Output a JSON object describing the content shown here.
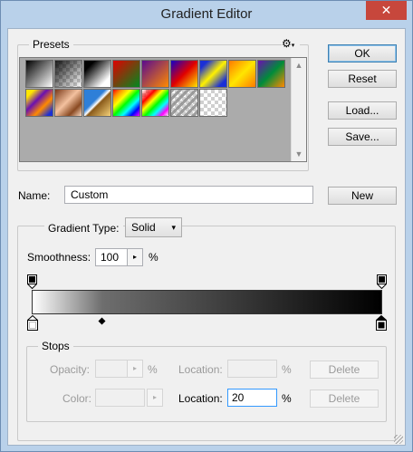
{
  "window": {
    "title": "Gradient Editor",
    "close_glyph": "✕"
  },
  "presets": {
    "label": "Presets",
    "menu_icon": "gear-icon",
    "swatches_row1": [
      "black-white-gradient",
      "transparent-black-gradient",
      "black-white-gradient-2",
      "red-green-gradient",
      "violet-orange-gradient",
      "blue-red-yellow-gradient",
      "blue-yellow-blue-gradient",
      "orange-yellow-orange-gradient",
      "violet-green-orange-gradient"
    ],
    "swatches_row2": [
      "yellow-violet-orange-blue-gradient",
      "copper-gradient",
      "chrome-gradient",
      "spectrum-gradient",
      "transparent-rainbow-gradient",
      "transparent-stripes-gradient",
      "transparent-checker-gradient"
    ]
  },
  "buttons": {
    "ok": "OK",
    "reset": "Reset",
    "load": "Load...",
    "save": "Save...",
    "new": "New"
  },
  "name": {
    "label": "Name:",
    "value": "Custom"
  },
  "gradient": {
    "type_label": "Gradient Type:",
    "type_value": "Solid",
    "smoothness_label": "Smoothness:",
    "smoothness_value": "100",
    "smoothness_unit": "%",
    "color_stops": [
      {
        "location": 0,
        "color": "#ffffff",
        "selected": true
      },
      {
        "location": 100,
        "color": "#000000",
        "selected": false
      }
    ],
    "opacity_stops": [
      {
        "location": 0,
        "opacity": 100
      },
      {
        "location": 100,
        "opacity": 100
      }
    ],
    "midpoint_location": 20
  },
  "stops": {
    "label": "Stops",
    "opacity_label": "Opacity:",
    "opacity_unit": "%",
    "location_label": "Location:",
    "location_unit": "%",
    "delete_label": "Delete",
    "color_label": "Color:",
    "color_location_label": "Location:",
    "color_location_value": "20",
    "color_location_unit": "%",
    "color_delete_label": "Delete"
  },
  "colors": {
    "title_bar": "#b9d1ea",
    "close_button": "#c7473c",
    "dialog_bg": "#f0f0f0"
  }
}
